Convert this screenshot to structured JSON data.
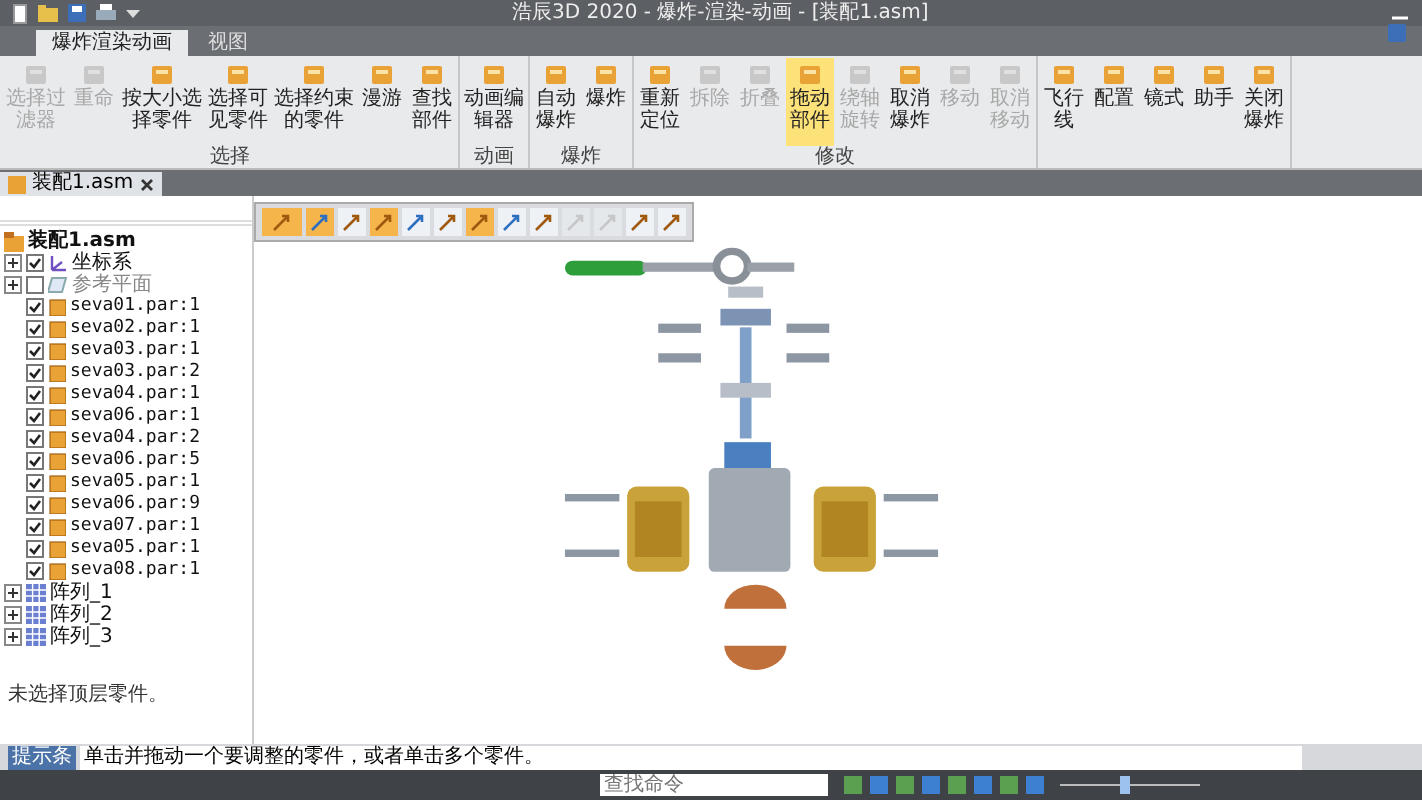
{
  "window": {
    "title": "浩辰3D 2020 - 爆炸-渲染-动画 - [装配1.asm]"
  },
  "ribbon_tabs": [
    {
      "label": "爆炸渲染动画",
      "selected": true
    },
    {
      "label": "视图",
      "selected": false
    }
  ],
  "ribbon_groups": [
    {
      "label": "选择",
      "buttons": [
        {
          "label": "选择过滤器",
          "disabled": true,
          "selected": false
        },
        {
          "label": "重命",
          "disabled": true,
          "selected": false
        },
        {
          "label": "按大小选择零件",
          "disabled": false,
          "selected": false
        },
        {
          "label": "选择可见零件",
          "disabled": false,
          "selected": false
        },
        {
          "label": "选择约束的零件",
          "disabled": false,
          "selected": false
        },
        {
          "label": "漫游",
          "disabled": false,
          "selected": false
        },
        {
          "label": "查找部件",
          "disabled": false,
          "selected": false
        }
      ]
    },
    {
      "label": "动画",
      "buttons": [
        {
          "label": "动画编辑器",
          "disabled": false,
          "selected": false
        }
      ]
    },
    {
      "label": "爆炸",
      "buttons": [
        {
          "label": "自动爆炸",
          "disabled": false,
          "selected": false
        },
        {
          "label": "爆炸",
          "disabled": false,
          "selected": false
        }
      ]
    },
    {
      "label": "修改",
      "buttons": [
        {
          "label": "重新定位",
          "disabled": false,
          "selected": false
        },
        {
          "label": "拆除",
          "disabled": true,
          "selected": false
        },
        {
          "label": "折叠",
          "disabled": true,
          "selected": false
        },
        {
          "label": "拖动部件",
          "disabled": false,
          "selected": true
        },
        {
          "label": "绕轴旋转",
          "disabled": true,
          "selected": false
        },
        {
          "label": "取消爆炸",
          "disabled": false,
          "selected": false
        },
        {
          "label": "移动",
          "disabled": true,
          "selected": false
        },
        {
          "label": "取消移动",
          "disabled": true,
          "selected": false
        }
      ]
    },
    {
      "buttons": [
        {
          "label": "飞行线",
          "disabled": false,
          "selected": false
        },
        {
          "label": "配置",
          "disabled": false,
          "selected": false
        },
        {
          "label": "镜式",
          "disabled": false,
          "selected": false
        },
        {
          "label": "助手",
          "disabled": false,
          "selected": false
        },
        {
          "label": "关闭爆炸",
          "disabled": false,
          "selected": false
        }
      ]
    }
  ],
  "document_tab": {
    "label": "装配1.asm"
  },
  "floating_toolbar": [
    {
      "selected": true,
      "disabled": false
    },
    {
      "selected": true,
      "disabled": false
    },
    {
      "selected": false,
      "disabled": false
    },
    {
      "selected": true,
      "disabled": false
    },
    {
      "selected": false,
      "disabled": false
    },
    {
      "selected": false,
      "disabled": false
    },
    {
      "selected": true,
      "disabled": false
    },
    {
      "selected": false,
      "disabled": false
    },
    {
      "selected": false,
      "disabled": false
    },
    {
      "selected": false,
      "disabled": true
    },
    {
      "selected": false,
      "disabled": true
    },
    {
      "selected": false,
      "disabled": false
    },
    {
      "selected": false,
      "disabled": false
    }
  ],
  "tree": {
    "label": "装配1.asm",
    "children": [
      {
        "kind": "coordinate",
        "label": "坐标系",
        "checked": true,
        "expanded": false
      },
      {
        "kind": "plane",
        "label": "参考平面",
        "checked": false,
        "expanded": false
      },
      {
        "kind": "part",
        "label": "seva01.par:1",
        "checked": true
      },
      {
        "kind": "part",
        "label": "seva02.par:1",
        "checked": true
      },
      {
        "kind": "part",
        "label": "seva03.par:1",
        "checked": true
      },
      {
        "kind": "part",
        "label": "seva03.par:2",
        "checked": true
      },
      {
        "kind": "part",
        "label": "seva04.par:1",
        "checked": true
      },
      {
        "kind": "part",
        "label": "seva06.par:1",
        "checked": true
      },
      {
        "kind": "part",
        "label": "seva04.par:2",
        "checked": true
      },
      {
        "kind": "part",
        "label": "seva06.par:5",
        "checked": true
      },
      {
        "kind": "part",
        "label": "seva05.par:1",
        "checked": true
      },
      {
        "kind": "part",
        "label": "seva06.par:9",
        "checked": true
      },
      {
        "kind": "part",
        "label": "seva07.par:1",
        "checked": true
      },
      {
        "kind": "part",
        "label": "seva05.par:1",
        "checked": true
      },
      {
        "kind": "part",
        "label": "seva08.par:1",
        "checked": true
      },
      {
        "kind": "pattern",
        "label": "阵列_1",
        "expanded": false
      },
      {
        "kind": "pattern",
        "label": "阵列_2",
        "expanded": false
      },
      {
        "kind": "pattern",
        "label": "阵列_3",
        "expanded": false
      }
    ]
  },
  "message": "未选择顶层零件。",
  "hint_bar": {
    "label": "提示条",
    "text": "单击并拖动一个要调整的零件，或者单击多个零件。"
  },
  "status_bar": {
    "search": {
      "placeholder": "查找命令"
    },
    "zoom_slider": {
      "level": 0.45
    }
  }
}
